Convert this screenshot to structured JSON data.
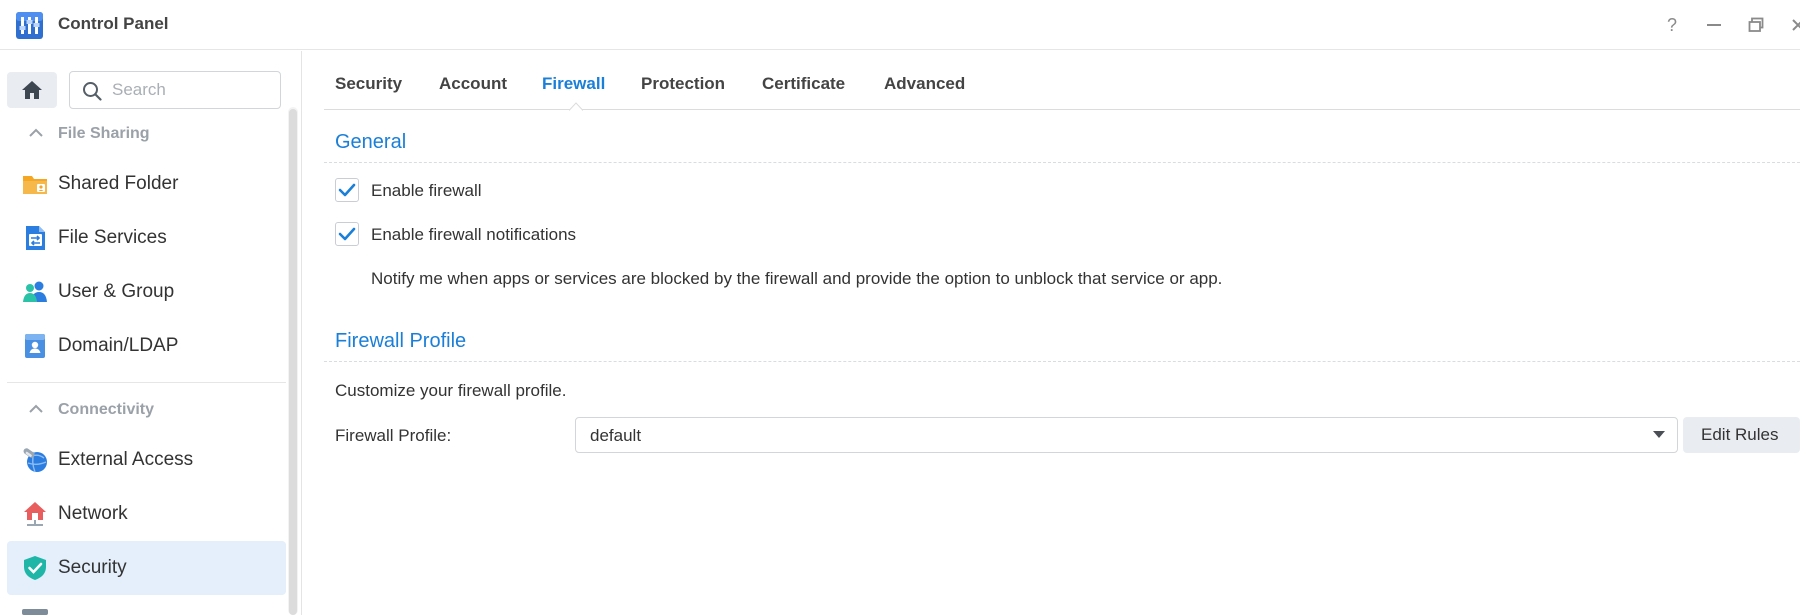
{
  "window": {
    "title": "Control Panel",
    "controls": {
      "help": "?",
      "minimize": "—",
      "restore": "▭",
      "close": "✕"
    }
  },
  "sidebar": {
    "search": {
      "placeholder": "Search",
      "value": ""
    },
    "groups": [
      {
        "label": "File Sharing"
      },
      {
        "label": "Connectivity"
      }
    ],
    "items": [
      {
        "label": "Shared Folder",
        "icon": "shared-folder-icon"
      },
      {
        "label": "File Services",
        "icon": "file-services-icon"
      },
      {
        "label": "User & Group",
        "icon": "user-group-icon"
      },
      {
        "label": "Domain/LDAP",
        "icon": "domain-ldap-icon"
      },
      {
        "label": "External Access",
        "icon": "external-access-icon"
      },
      {
        "label": "Network",
        "icon": "network-icon"
      },
      {
        "label": "Security",
        "icon": "security-shield-icon",
        "active": true
      }
    ]
  },
  "tabs": [
    {
      "label": "Security"
    },
    {
      "label": "Account"
    },
    {
      "label": "Firewall",
      "active": true
    },
    {
      "label": "Protection"
    },
    {
      "label": "Certificate"
    },
    {
      "label": "Advanced"
    }
  ],
  "general": {
    "title": "General",
    "enable_firewall": {
      "label": "Enable firewall",
      "checked": true
    },
    "enable_notifications": {
      "label": "Enable firewall notifications",
      "checked": true
    },
    "notify_description": "Notify me when apps or services are blocked by the firewall and provide the option to unblock that service or app."
  },
  "profile": {
    "title": "Firewall Profile",
    "description": "Customize your firewall profile.",
    "field_label": "Firewall Profile:",
    "selected": "default",
    "edit_button": "Edit Rules"
  },
  "colors": {
    "accent": "#1a7fd8",
    "active_item_bg": "#e4effb",
    "button_bg": "#e9edf1"
  }
}
